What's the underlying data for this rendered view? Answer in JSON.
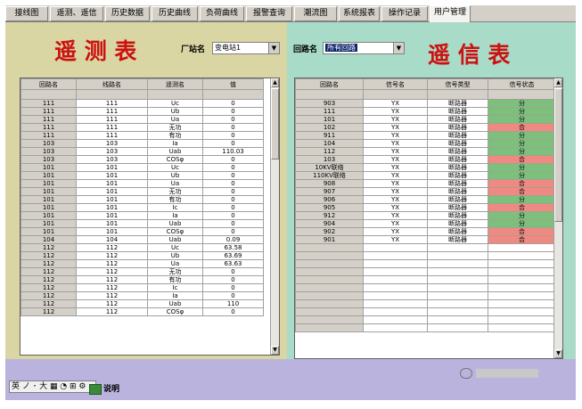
{
  "tabs": [
    {
      "label": "接线图"
    },
    {
      "label": "遥测、遥信"
    },
    {
      "label": "历史数据"
    },
    {
      "label": "历史曲线"
    },
    {
      "label": "负荷曲线"
    },
    {
      "label": "报警查询"
    },
    {
      "label": "潮流图"
    },
    {
      "label": "系统报表"
    },
    {
      "label": "操作记录"
    },
    {
      "label": "用户管理"
    }
  ],
  "telemetry": {
    "title": "遥 测 表",
    "station_label": "厂站名",
    "station_value": "变电站1",
    "columns": [
      "回路名",
      "线路名",
      "遥测名",
      "值"
    ],
    "rows": [
      [
        "111",
        "111",
        "Uc",
        "0"
      ],
      [
        "111",
        "111",
        "Ub",
        "0"
      ],
      [
        "111",
        "111",
        "Ua",
        "0"
      ],
      [
        "111",
        "111",
        "无功",
        "0"
      ],
      [
        "111",
        "111",
        "有功",
        "0"
      ],
      [
        "103",
        "103",
        "Ia",
        "0"
      ],
      [
        "103",
        "103",
        "Uab",
        "110.03"
      ],
      [
        "103",
        "103",
        "COSφ",
        "0"
      ],
      [
        "101",
        "101",
        "Uc",
        "0"
      ],
      [
        "101",
        "101",
        "Ub",
        "0"
      ],
      [
        "101",
        "101",
        "Ua",
        "0"
      ],
      [
        "101",
        "101",
        "无功",
        "0"
      ],
      [
        "101",
        "101",
        "有功",
        "0"
      ],
      [
        "101",
        "101",
        "Ic",
        "0"
      ],
      [
        "101",
        "101",
        "Ia",
        "0"
      ],
      [
        "101",
        "101",
        "Uab",
        "0"
      ],
      [
        "101",
        "101",
        "COSφ",
        "0"
      ],
      [
        "104",
        "104",
        "Uab",
        "0.09"
      ],
      [
        "112",
        "112",
        "Uc",
        "63.58"
      ],
      [
        "112",
        "112",
        "Ub",
        "63.69"
      ],
      [
        "112",
        "112",
        "Ua",
        "63.63"
      ],
      [
        "112",
        "112",
        "无功",
        "0"
      ],
      [
        "112",
        "112",
        "有功",
        "0"
      ],
      [
        "112",
        "112",
        "Ic",
        "0"
      ],
      [
        "112",
        "112",
        "Ia",
        "0"
      ],
      [
        "112",
        "112",
        "Uab",
        "110"
      ],
      [
        "112",
        "112",
        "COSφ",
        "0"
      ]
    ]
  },
  "signals": {
    "title": "遥 信 表",
    "loop_label": "回路名",
    "loop_value": "所有回路",
    "columns": [
      "回路名",
      "信号名",
      "信号类型",
      "信号状态"
    ],
    "rows": [
      [
        "903",
        "YX",
        "断路器",
        "分"
      ],
      [
        "111",
        "YX",
        "断路器",
        "分"
      ],
      [
        "101",
        "YX",
        "断路器",
        "分"
      ],
      [
        "102",
        "YX",
        "断路器",
        "合"
      ],
      [
        "911",
        "YX",
        "断路器",
        "分"
      ],
      [
        "104",
        "YX",
        "断路器",
        "分"
      ],
      [
        "112",
        "YX",
        "断路器",
        "分"
      ],
      [
        "103",
        "YX",
        "断路器",
        "合"
      ],
      [
        "10KV联络",
        "YX",
        "断路器",
        "分"
      ],
      [
        "110KV联络",
        "YX",
        "断路器",
        "分"
      ],
      [
        "908",
        "YX",
        "断路器",
        "合"
      ],
      [
        "907",
        "YX",
        "断路器",
        "合"
      ],
      [
        "906",
        "YX",
        "断路器",
        "分"
      ],
      [
        "905",
        "YX",
        "断路器",
        "合"
      ],
      [
        "912",
        "YX",
        "断路器",
        "分"
      ],
      [
        "904",
        "YX",
        "断路器",
        "分"
      ],
      [
        "902",
        "YX",
        "断路器",
        "合"
      ],
      [
        "901",
        "YX",
        "断路器",
        "合"
      ]
    ],
    "status_colors": {
      "分": "#7cc07a",
      "合": "#f08a80"
    }
  },
  "bottom": {
    "ime_text": "英 ノ ･ 大 ▦ ◔ ⊞ ⚙",
    "help_label": "说明"
  }
}
